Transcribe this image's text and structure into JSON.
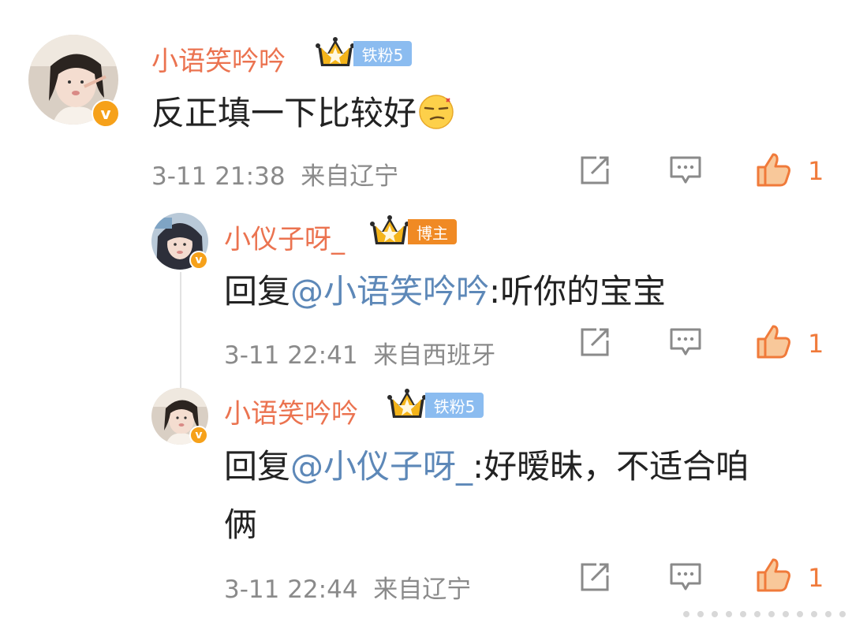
{
  "colors": {
    "username": "#eb7350",
    "mention": "#5d88b8",
    "meta": "#8a8a8a",
    "like": "#f07a3a",
    "fan_badge": "#8bbcf0",
    "host_badge": "#f08a24"
  },
  "comments": [
    {
      "username": "小语笑吟吟",
      "badge": "铁粉5",
      "badge_type": "fan",
      "content": "反正填一下比较好",
      "emoji": "smirk-emoji",
      "time": "3-11 21:38",
      "location": "来自辽宁",
      "likes": "1"
    },
    {
      "username": "小仪子呀_",
      "badge": "博主",
      "badge_type": "host",
      "reply_prefix": "回复",
      "mention": "@小语笑吟吟",
      "content": ":听你的宝宝",
      "time": "3-11 22:41",
      "location": "来自西班牙",
      "likes": "1"
    },
    {
      "username": "小语笑吟吟",
      "badge": "铁粉5",
      "badge_type": "fan",
      "reply_prefix": "回复",
      "mention": "@小仪子呀_",
      "content": ":好暧昧，不适合咱",
      "content_line2": "俩",
      "time": "3-11 22:44",
      "location": "来自辽宁",
      "likes": "1"
    }
  ],
  "icons": {
    "repost": "repost-icon",
    "comment": "comment-icon",
    "like": "thumbs-up-icon",
    "verified": "verified-v-icon",
    "crown": "crown-icon"
  }
}
